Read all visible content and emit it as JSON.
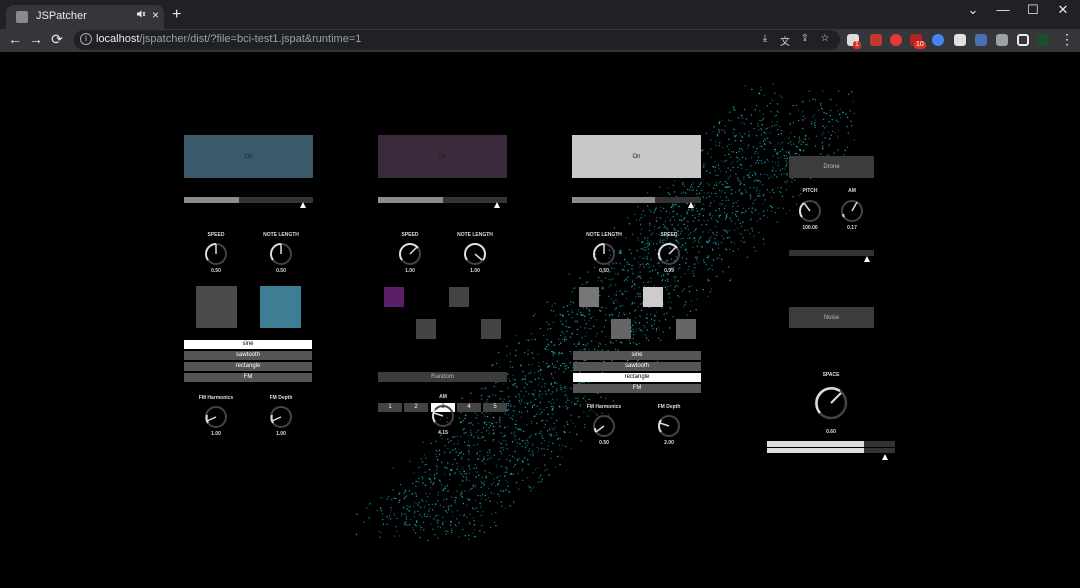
{
  "browser": {
    "tab_title": "JSPatcher",
    "tab_audio_icon": "speaker-icon",
    "tab_close": "×",
    "new_tab": "+",
    "url_host": "localhost",
    "url_path": "/jspatcher/dist/?file=bci-test1.jspat&runtime=1",
    "back": "←",
    "forward": "→",
    "reload": "⟳",
    "minimize": "—",
    "maximize": "☐",
    "close": "✕",
    "chevron": "⌄",
    "info": "i",
    "badge_1": "1",
    "badge_2": "10",
    "menu": "⋮"
  },
  "colors": {
    "pad1": "#3a5a6b",
    "pad2": "#3a2a3b",
    "pad3": "#c8c8c8",
    "teal_square": "#3d7e95",
    "purple_square": "#5b1f6a",
    "scatter": "#1fc9d6"
  },
  "patch": {
    "voice1": {
      "pad_label": "On",
      "slider_fill": 0.43,
      "speed_label": "SPEED",
      "speed_value": "0.50",
      "length_label": "NOTE LENGTH",
      "length_value": "0.50",
      "waves": [
        "sine",
        "sawtooth",
        "rectangle",
        "FM"
      ],
      "wave_selected": 0,
      "fm_harm_label": "FM Harmonics",
      "fm_harm_value": "1.00",
      "fm_depth_label": "FM Depth",
      "fm_depth_value": "1.00"
    },
    "voice2": {
      "pad_label": "On",
      "slider_fill": 0.5,
      "speed_label": "SPEED",
      "speed_value": "1.00",
      "length_label": "NOTE LENGTH",
      "length_value": "1.00",
      "numbers": [
        "1",
        "2",
        "3",
        "4",
        "5"
      ],
      "number_selected": 2,
      "random_label": "Random",
      "am_label": "AM",
      "am_value": "4.15"
    },
    "voice3": {
      "pad_label": "On",
      "slider_fill": 0.64,
      "length_label": "NOTE LENGTH",
      "length_value": "0.50",
      "speed_label": "SPEED",
      "speed_value": "0.99",
      "waves": [
        "sine",
        "sawtooth",
        "rectangle",
        "FM"
      ],
      "wave_selected": 2,
      "fm_harm_label": "FM Harmonics",
      "fm_harm_value": "0.50",
      "fm_depth_label": "FM Depth",
      "fm_depth_value": "2.00"
    },
    "drone": {
      "button_label": "Drone",
      "pitch_label": "PITCH",
      "pitch_value": "100.00",
      "am_label": "AM",
      "am_value": "0.17"
    },
    "noise": {
      "button_label": "Noise",
      "space_label": "SPACE",
      "space_value": "0.60"
    }
  }
}
